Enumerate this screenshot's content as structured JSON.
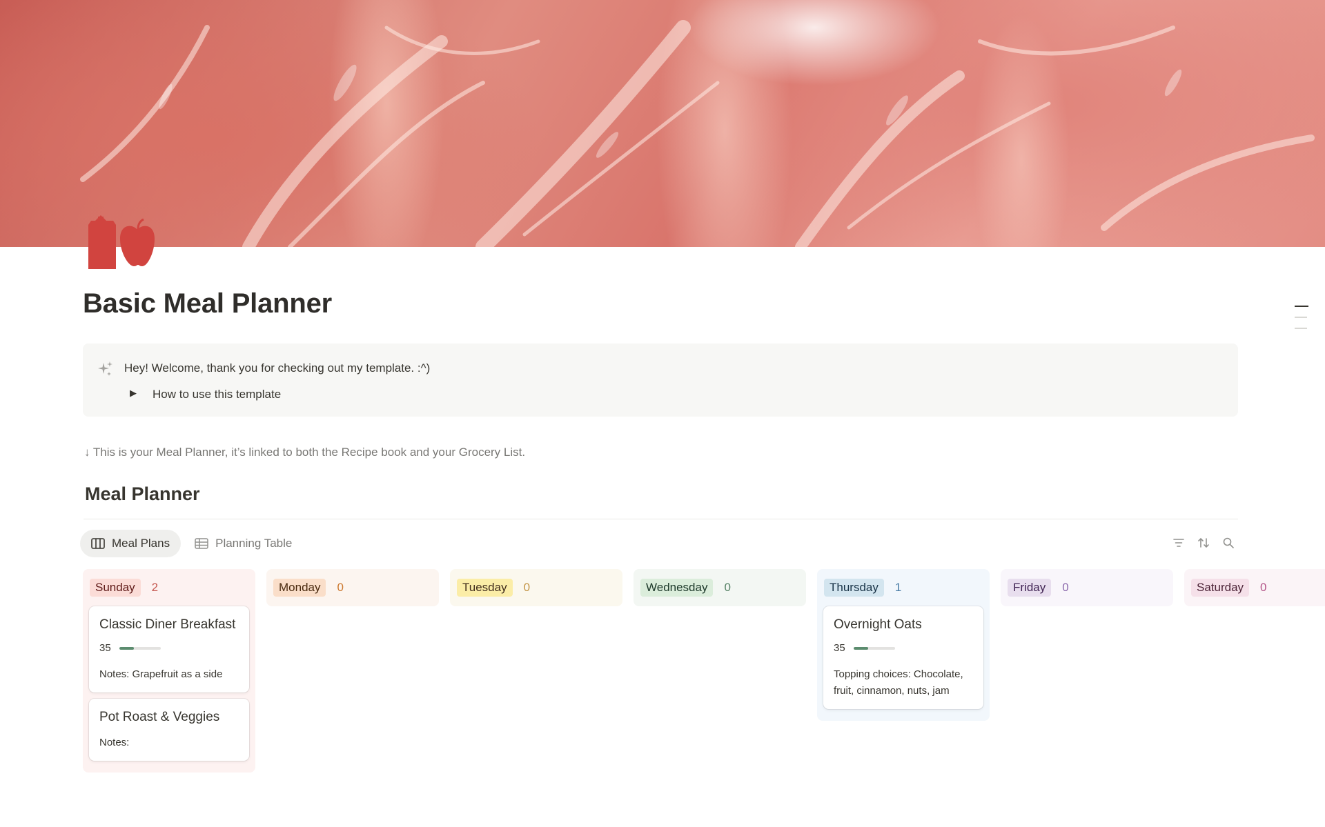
{
  "page": {
    "title": "Basic Meal Planner",
    "icon": "lunchbox-apple-icon"
  },
  "callout": {
    "icon": "sparkles-icon",
    "welcome": "Hey! Welcome, thank you for checking out my template. :^)",
    "toggle_label": "How to use this template",
    "toggle_arrow": "▶"
  },
  "description": "↓ This is your Meal Planner, it’s linked to both the Recipe book and your Grocery List.",
  "section_title": "Meal Planner",
  "views": {
    "tabs": [
      {
        "label": "Meal Plans",
        "icon": "board-icon",
        "active": true
      },
      {
        "label": "Planning Table",
        "icon": "table-icon",
        "active": false
      }
    ],
    "tools": [
      "filter-icon",
      "sort-icon",
      "search-icon"
    ]
  },
  "columns": [
    {
      "label": "Sunday",
      "count": "2",
      "colors": {
        "bg": "#fdf2f1",
        "tag": "#fbdcd7",
        "text": "#5d1715",
        "count": "#c4554d"
      },
      "cards": [
        {
          "title": "Classic Diner Breakfast",
          "rating": "35",
          "rating_fraction": 0.35,
          "notes": "Notes: Grapefruit as a side"
        },
        {
          "title": "Pot Roast & Veggies",
          "notes": "Notes:"
        }
      ]
    },
    {
      "label": "Monday",
      "count": "0",
      "colors": {
        "bg": "#fcf5f0",
        "tag": "#fadec9",
        "text": "#49290e",
        "count": "#cc782f"
      },
      "cards": []
    },
    {
      "label": "Tuesday",
      "count": "0",
      "colors": {
        "bg": "#fbf8ee",
        "tag": "#fbeda7",
        "text": "#402c1b",
        "count": "#c29343"
      },
      "cards": []
    },
    {
      "label": "Wednesday",
      "count": "0",
      "colors": {
        "bg": "#f3f7f3",
        "tag": "#dbeddb",
        "text": "#1c3829",
        "count": "#548164"
      },
      "cards": []
    },
    {
      "label": "Thursday",
      "count": "1",
      "colors": {
        "bg": "#f2f7fc",
        "tag": "#d3e5ef",
        "text": "#183347",
        "count": "#487ca5"
      },
      "cards": [
        {
          "title": "Overnight Oats",
          "rating": "35",
          "rating_fraction": 0.35,
          "notes": "Topping choices: Chocolate, fruit, cinnamon, nuts, jam"
        }
      ]
    },
    {
      "label": "Friday",
      "count": "0",
      "colors": {
        "bg": "#f9f6fb",
        "tag": "#e8deee",
        "text": "#412454",
        "count": "#8a67ab"
      },
      "cards": []
    },
    {
      "label": "Saturday",
      "count": "0",
      "colors": {
        "bg": "#fbf4f7",
        "tag": "#f5e0e9",
        "text": "#4c2337",
        "count": "#b35488"
      },
      "cards": []
    }
  ]
}
